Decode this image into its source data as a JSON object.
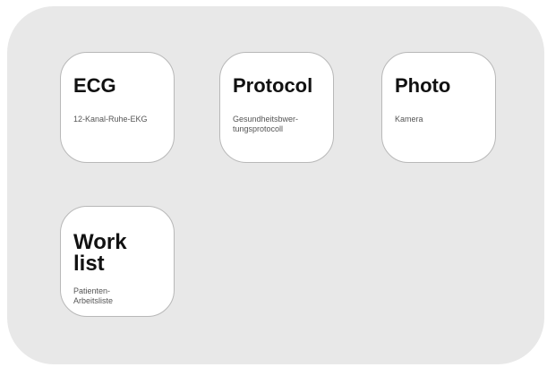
{
  "tiles": [
    {
      "id": "ecg",
      "title": "ECG",
      "subtitle": "12-Kanal-Ruhe-EKG"
    },
    {
      "id": "protocol",
      "title": "Protocol",
      "subtitle": "Gesundheitsbwer-\ntungsprotocoll"
    },
    {
      "id": "photo",
      "title": "Photo",
      "subtitle": "Kamera"
    },
    {
      "id": "worklist",
      "title": "Work\nlist",
      "subtitle": "Patienten-\nArbeitsliste"
    }
  ]
}
